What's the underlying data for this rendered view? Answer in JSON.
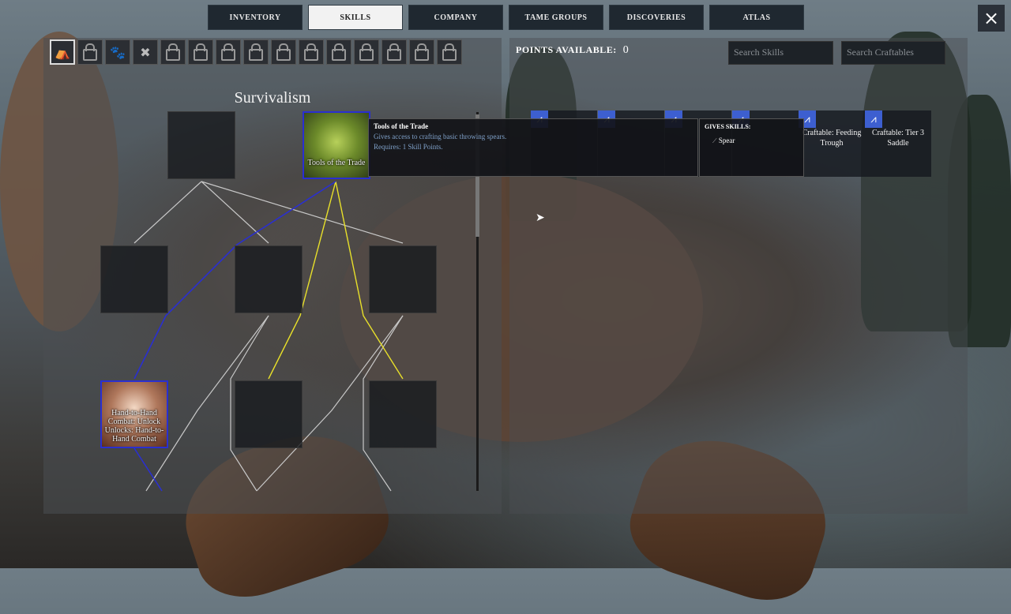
{
  "tabs": [
    {
      "label": "INVENTORY",
      "active": false
    },
    {
      "label": "SKILLS",
      "active": true
    },
    {
      "label": "COMPANY",
      "active": false
    },
    {
      "label": "TAME GROUPS",
      "active": false
    },
    {
      "label": "DISCOVERIES",
      "active": false
    },
    {
      "label": "ATLAS",
      "active": false
    }
  ],
  "close_icon": "×",
  "section_title": "Survivalism",
  "points": {
    "label": "POINTS AVAILABLE:",
    "value": "0"
  },
  "search_skills": {
    "placeholder": "Search Skills"
  },
  "search_craftables": {
    "placeholder": "Search Craftables"
  },
  "nodes": {
    "hand_to_hand": "Hand-to-Hand Combat: Unlock Unlocks: Hand-to-Hand Combat",
    "tools_of_trade": "Tools of the Trade"
  },
  "tooltip": {
    "title": "Tools of the Trade",
    "desc": "Gives access to crafting basic throwing spears.",
    "req": "Requires: 1 Skill Points."
  },
  "gives": {
    "header": "GIVES SKILLS:",
    "item": "Spear"
  },
  "craftables": [
    {
      "label": "Craftable: Feeding Trough"
    },
    {
      "label": "Craftable: Tier 3 Saddle"
    }
  ]
}
